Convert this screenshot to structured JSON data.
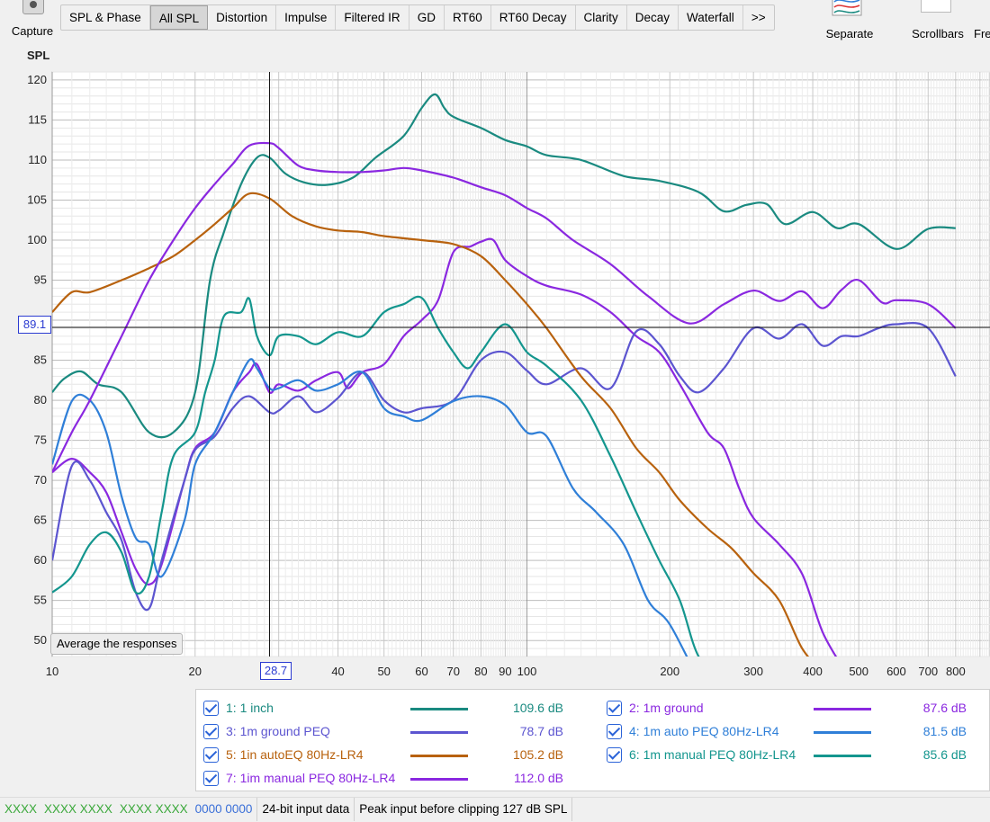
{
  "toolbar": {
    "capture_label": "Capture",
    "tabs": [
      "SPL & Phase",
      "All SPL",
      "Distortion",
      "Impulse",
      "Filtered IR",
      "GD",
      "RT60",
      "RT60 Decay",
      "Clarity",
      "Decay",
      "Waterfall",
      ">>"
    ],
    "active_tab": "All SPL",
    "separate_label": "Separate",
    "scrollbars_label": "Scrollbars",
    "freq_label": "Fre"
  },
  "average_button": "Average the responses",
  "cursor": {
    "x_label": "28.7",
    "y_label": "89.1",
    "x": 28.7,
    "y": 89.1
  },
  "status": {
    "meters": [
      "XXXX",
      "XXXX XXXX",
      "XXXX XXXX",
      "0000 0000"
    ],
    "bitdepth": "24-bit input data",
    "clipping": "Peak input before clipping 127 dB SPL"
  },
  "chart_data": {
    "type": "line",
    "title": "",
    "ylabel": "SPL",
    "xlabel": "",
    "xscale": "log",
    "xlim": [
      10,
      800
    ],
    "ylim": [
      48,
      121
    ],
    "xticks": [
      10,
      20,
      28.7,
      40,
      50,
      60,
      70,
      80,
      90,
      100,
      200,
      300,
      400,
      500,
      600,
      700,
      800
    ],
    "xtick_labels": [
      "10",
      "20",
      "",
      "40",
      "50",
      "60",
      "70",
      "80",
      "90",
      "100",
      "200",
      "300",
      "400",
      "500",
      "600",
      "700",
      "800"
    ],
    "yticks": [
      50,
      55,
      60,
      65,
      70,
      75,
      80,
      85,
      90,
      95,
      100,
      105,
      110,
      115,
      120
    ],
    "ytick_labels": [
      "50",
      "55",
      "60",
      "65",
      "70",
      "75",
      "80",
      "85",
      "",
      "95",
      "100",
      "105",
      "110",
      "115",
      "120"
    ],
    "grid": true,
    "legend_position": "bottom",
    "series": [
      {
        "name": "1: 1 inch",
        "value": "109.6 dB",
        "color": "#1a8a80",
        "points": [
          [
            10,
            81
          ],
          [
            10.6,
            82.7
          ],
          [
            11.5,
            83.6
          ],
          [
            12.5,
            82
          ],
          [
            14,
            81
          ],
          [
            16,
            76
          ],
          [
            18,
            76
          ],
          [
            20,
            81
          ],
          [
            21.5,
            95
          ],
          [
            23,
            101
          ],
          [
            25,
            107
          ],
          [
            27,
            110.3
          ],
          [
            28.7,
            110.3
          ],
          [
            31,
            108.3
          ],
          [
            34,
            107.2
          ],
          [
            38,
            106.9
          ],
          [
            43,
            107.8
          ],
          [
            48,
            110.3
          ],
          [
            55,
            113
          ],
          [
            60,
            116.5
          ],
          [
            64,
            118.2
          ],
          [
            67,
            116.5
          ],
          [
            70,
            115.4
          ],
          [
            80,
            114
          ],
          [
            90,
            112.5
          ],
          [
            100,
            111.7
          ],
          [
            110,
            110.6
          ],
          [
            130,
            110
          ],
          [
            160,
            108
          ],
          [
            190,
            107.4
          ],
          [
            230,
            106
          ],
          [
            260,
            103.6
          ],
          [
            290,
            104.4
          ],
          [
            320,
            104.5
          ],
          [
            350,
            102
          ],
          [
            400,
            103.5
          ],
          [
            450,
            101.5
          ],
          [
            500,
            102
          ],
          [
            600,
            98.9
          ],
          [
            700,
            101.4
          ],
          [
            800,
            101.5
          ]
        ]
      },
      {
        "name": "2: 1m ground",
        "value": "87.6 dB",
        "color": "#8a28e0",
        "points": [
          [
            10,
            71
          ],
          [
            11,
            72.7
          ],
          [
            12,
            71
          ],
          [
            13,
            68.5
          ],
          [
            14,
            63.5
          ],
          [
            15,
            58.9
          ],
          [
            16,
            57
          ],
          [
            17,
            59.5
          ],
          [
            19,
            70
          ],
          [
            20,
            74
          ],
          [
            22,
            76
          ],
          [
            24,
            81
          ],
          [
            26,
            83.5
          ],
          [
            27,
            84.5
          ],
          [
            28.7,
            81
          ],
          [
            30,
            82
          ],
          [
            33,
            81.2
          ],
          [
            36,
            82.5
          ],
          [
            40,
            83.5
          ],
          [
            42,
            81.5
          ],
          [
            45,
            83.5
          ],
          [
            50,
            84.5
          ],
          [
            55,
            88
          ],
          [
            60,
            90
          ],
          [
            65,
            92.5
          ],
          [
            70,
            98.5
          ],
          [
            76,
            99.2
          ],
          [
            80,
            99.8
          ],
          [
            85,
            100
          ],
          [
            90,
            97.5
          ],
          [
            100,
            95.5
          ],
          [
            110,
            94.3
          ],
          [
            130,
            93.2
          ],
          [
            150,
            91
          ],
          [
            170,
            88
          ],
          [
            190,
            86
          ],
          [
            210,
            82
          ],
          [
            240,
            76
          ],
          [
            260,
            74
          ],
          [
            280,
            69
          ],
          [
            300,
            65.3
          ],
          [
            340,
            62
          ],
          [
            380,
            58.3
          ],
          [
            420,
            51
          ],
          [
            470,
            46
          ]
        ]
      },
      {
        "name": "3: 1m ground PEQ",
        "value": "78.7 dB",
        "color": "#5c55d0",
        "points": [
          [
            10,
            60
          ],
          [
            11,
            71.8
          ],
          [
            12,
            70
          ],
          [
            13,
            66
          ],
          [
            14,
            62.5
          ],
          [
            15,
            56
          ],
          [
            16,
            54
          ],
          [
            17,
            60
          ],
          [
            19,
            70
          ],
          [
            20,
            73.8
          ],
          [
            22,
            75.5
          ],
          [
            24,
            79
          ],
          [
            26,
            80.5
          ],
          [
            28.7,
            78.5
          ],
          [
            30,
            78.7
          ],
          [
            33,
            80.5
          ],
          [
            36,
            78.5
          ],
          [
            40,
            80.3
          ],
          [
            45,
            83.5
          ],
          [
            50,
            80
          ],
          [
            55,
            78.5
          ],
          [
            60,
            79
          ],
          [
            70,
            80
          ],
          [
            80,
            85
          ],
          [
            90,
            86
          ],
          [
            100,
            83.7
          ],
          [
            110,
            82
          ],
          [
            130,
            84
          ],
          [
            150,
            81.5
          ],
          [
            170,
            88.6
          ],
          [
            190,
            87
          ],
          [
            210,
            83
          ],
          [
            230,
            81
          ],
          [
            260,
            84
          ],
          [
            300,
            89
          ],
          [
            340,
            87.7
          ],
          [
            380,
            89.5
          ],
          [
            420,
            86.8
          ],
          [
            460,
            88
          ],
          [
            500,
            88
          ],
          [
            550,
            89
          ],
          [
            600,
            89.5
          ],
          [
            700,
            89
          ],
          [
            800,
            83
          ]
        ]
      },
      {
        "name": "4: 1m auto PEQ 80Hz-LR4",
        "value": "81.5 dB",
        "color": "#2f7fd8",
        "points": [
          [
            10,
            72
          ],
          [
            11,
            79.9
          ],
          [
            12,
            80
          ],
          [
            13,
            76
          ],
          [
            14,
            68
          ],
          [
            15,
            62.8
          ],
          [
            16,
            62
          ],
          [
            17,
            58
          ],
          [
            19,
            65
          ],
          [
            20,
            72
          ],
          [
            22,
            76
          ],
          [
            24,
            81
          ],
          [
            26,
            85
          ],
          [
            27,
            84
          ],
          [
            28.7,
            81.5
          ],
          [
            30,
            81.5
          ],
          [
            33,
            82.5
          ],
          [
            36,
            81.2
          ],
          [
            40,
            82
          ],
          [
            45,
            83.5
          ],
          [
            50,
            79
          ],
          [
            55,
            78
          ],
          [
            60,
            77.5
          ],
          [
            70,
            79.9
          ],
          [
            80,
            80.5
          ],
          [
            90,
            79.4
          ],
          [
            100,
            76
          ],
          [
            110,
            75.5
          ],
          [
            125,
            69
          ],
          [
            140,
            66
          ],
          [
            160,
            62
          ],
          [
            180,
            55
          ],
          [
            200,
            52
          ],
          [
            230,
            45
          ]
        ]
      },
      {
        "name": "5: 1in autoEQ 80Hz-LR4",
        "value": "105.2 dB",
        "color": "#b8620e",
        "points": [
          [
            10,
            91
          ],
          [
            11,
            93.5
          ],
          [
            12,
            93.5
          ],
          [
            14,
            95
          ],
          [
            16,
            96.5
          ],
          [
            18,
            98
          ],
          [
            20,
            100
          ],
          [
            22,
            102
          ],
          [
            24,
            104
          ],
          [
            26,
            105.8
          ],
          [
            28.7,
            105.2
          ],
          [
            32,
            103
          ],
          [
            36,
            101.7
          ],
          [
            40,
            101.2
          ],
          [
            45,
            101
          ],
          [
            50,
            100.5
          ],
          [
            60,
            100
          ],
          [
            70,
            99.5
          ],
          [
            80,
            98
          ],
          [
            90,
            95
          ],
          [
            100,
            92
          ],
          [
            110,
            89
          ],
          [
            130,
            83
          ],
          [
            150,
            79
          ],
          [
            170,
            74
          ],
          [
            190,
            71
          ],
          [
            210,
            67.5
          ],
          [
            240,
            64
          ],
          [
            270,
            61.5
          ],
          [
            300,
            58.4
          ],
          [
            340,
            55
          ],
          [
            380,
            49
          ],
          [
            420,
            46
          ]
        ]
      },
      {
        "name": "6: 1m manual PEQ 80Hz-LR4",
        "value": "85.6 dB",
        "color": "#14968e",
        "points": [
          [
            10,
            56
          ],
          [
            11,
            58
          ],
          [
            12,
            62
          ],
          [
            13,
            63.5
          ],
          [
            14,
            61
          ],
          [
            15,
            56
          ],
          [
            16,
            58
          ],
          [
            17,
            66
          ],
          [
            18,
            73
          ],
          [
            20,
            76
          ],
          [
            21,
            81
          ],
          [
            22,
            85
          ],
          [
            23,
            90.5
          ],
          [
            25,
            91
          ],
          [
            26,
            92.7
          ],
          [
            27,
            88
          ],
          [
            28.7,
            85.6
          ],
          [
            30,
            88
          ],
          [
            33,
            88
          ],
          [
            36,
            87
          ],
          [
            40,
            88.5
          ],
          [
            45,
            88
          ],
          [
            50,
            91
          ],
          [
            55,
            92
          ],
          [
            60,
            92.8
          ],
          [
            65,
            89
          ],
          [
            70,
            86
          ],
          [
            75,
            84
          ],
          [
            80,
            86
          ],
          [
            90,
            89.5
          ],
          [
            100,
            86
          ],
          [
            110,
            84.3
          ],
          [
            130,
            80
          ],
          [
            150,
            73
          ],
          [
            170,
            66
          ],
          [
            190,
            60
          ],
          [
            210,
            55
          ],
          [
            230,
            48
          ],
          [
            260,
            45
          ]
        ]
      },
      {
        "name": "7: 1im manual PEQ 80Hz-LR4",
        "value": "112.0 dB",
        "color": "#8a28e0",
        "points": [
          [
            10,
            71
          ],
          [
            11,
            76
          ],
          [
            12,
            80
          ],
          [
            14,
            88
          ],
          [
            16,
            95
          ],
          [
            18,
            100
          ],
          [
            20,
            104
          ],
          [
            22,
            107
          ],
          [
            24,
            109.5
          ],
          [
            26,
            111.8
          ],
          [
            28.7,
            112.1
          ],
          [
            30,
            111.5
          ],
          [
            33,
            109.3
          ],
          [
            36,
            108.7
          ],
          [
            40,
            108.5
          ],
          [
            45,
            108.5
          ],
          [
            50,
            108.7
          ],
          [
            55,
            109
          ],
          [
            60,
            108.7
          ],
          [
            70,
            107.8
          ],
          [
            80,
            106.6
          ],
          [
            90,
            105.6
          ],
          [
            100,
            104
          ],
          [
            110,
            102.7
          ],
          [
            125,
            100
          ],
          [
            150,
            97
          ],
          [
            180,
            93
          ],
          [
            220,
            89.6
          ],
          [
            260,
            92
          ],
          [
            300,
            93.7
          ],
          [
            340,
            92.4
          ],
          [
            380,
            93.6
          ],
          [
            420,
            91.5
          ],
          [
            460,
            93.8
          ],
          [
            500,
            95
          ],
          [
            560,
            92.2
          ],
          [
            600,
            92.5
          ],
          [
            700,
            92
          ],
          [
            800,
            89
          ]
        ]
      }
    ]
  }
}
